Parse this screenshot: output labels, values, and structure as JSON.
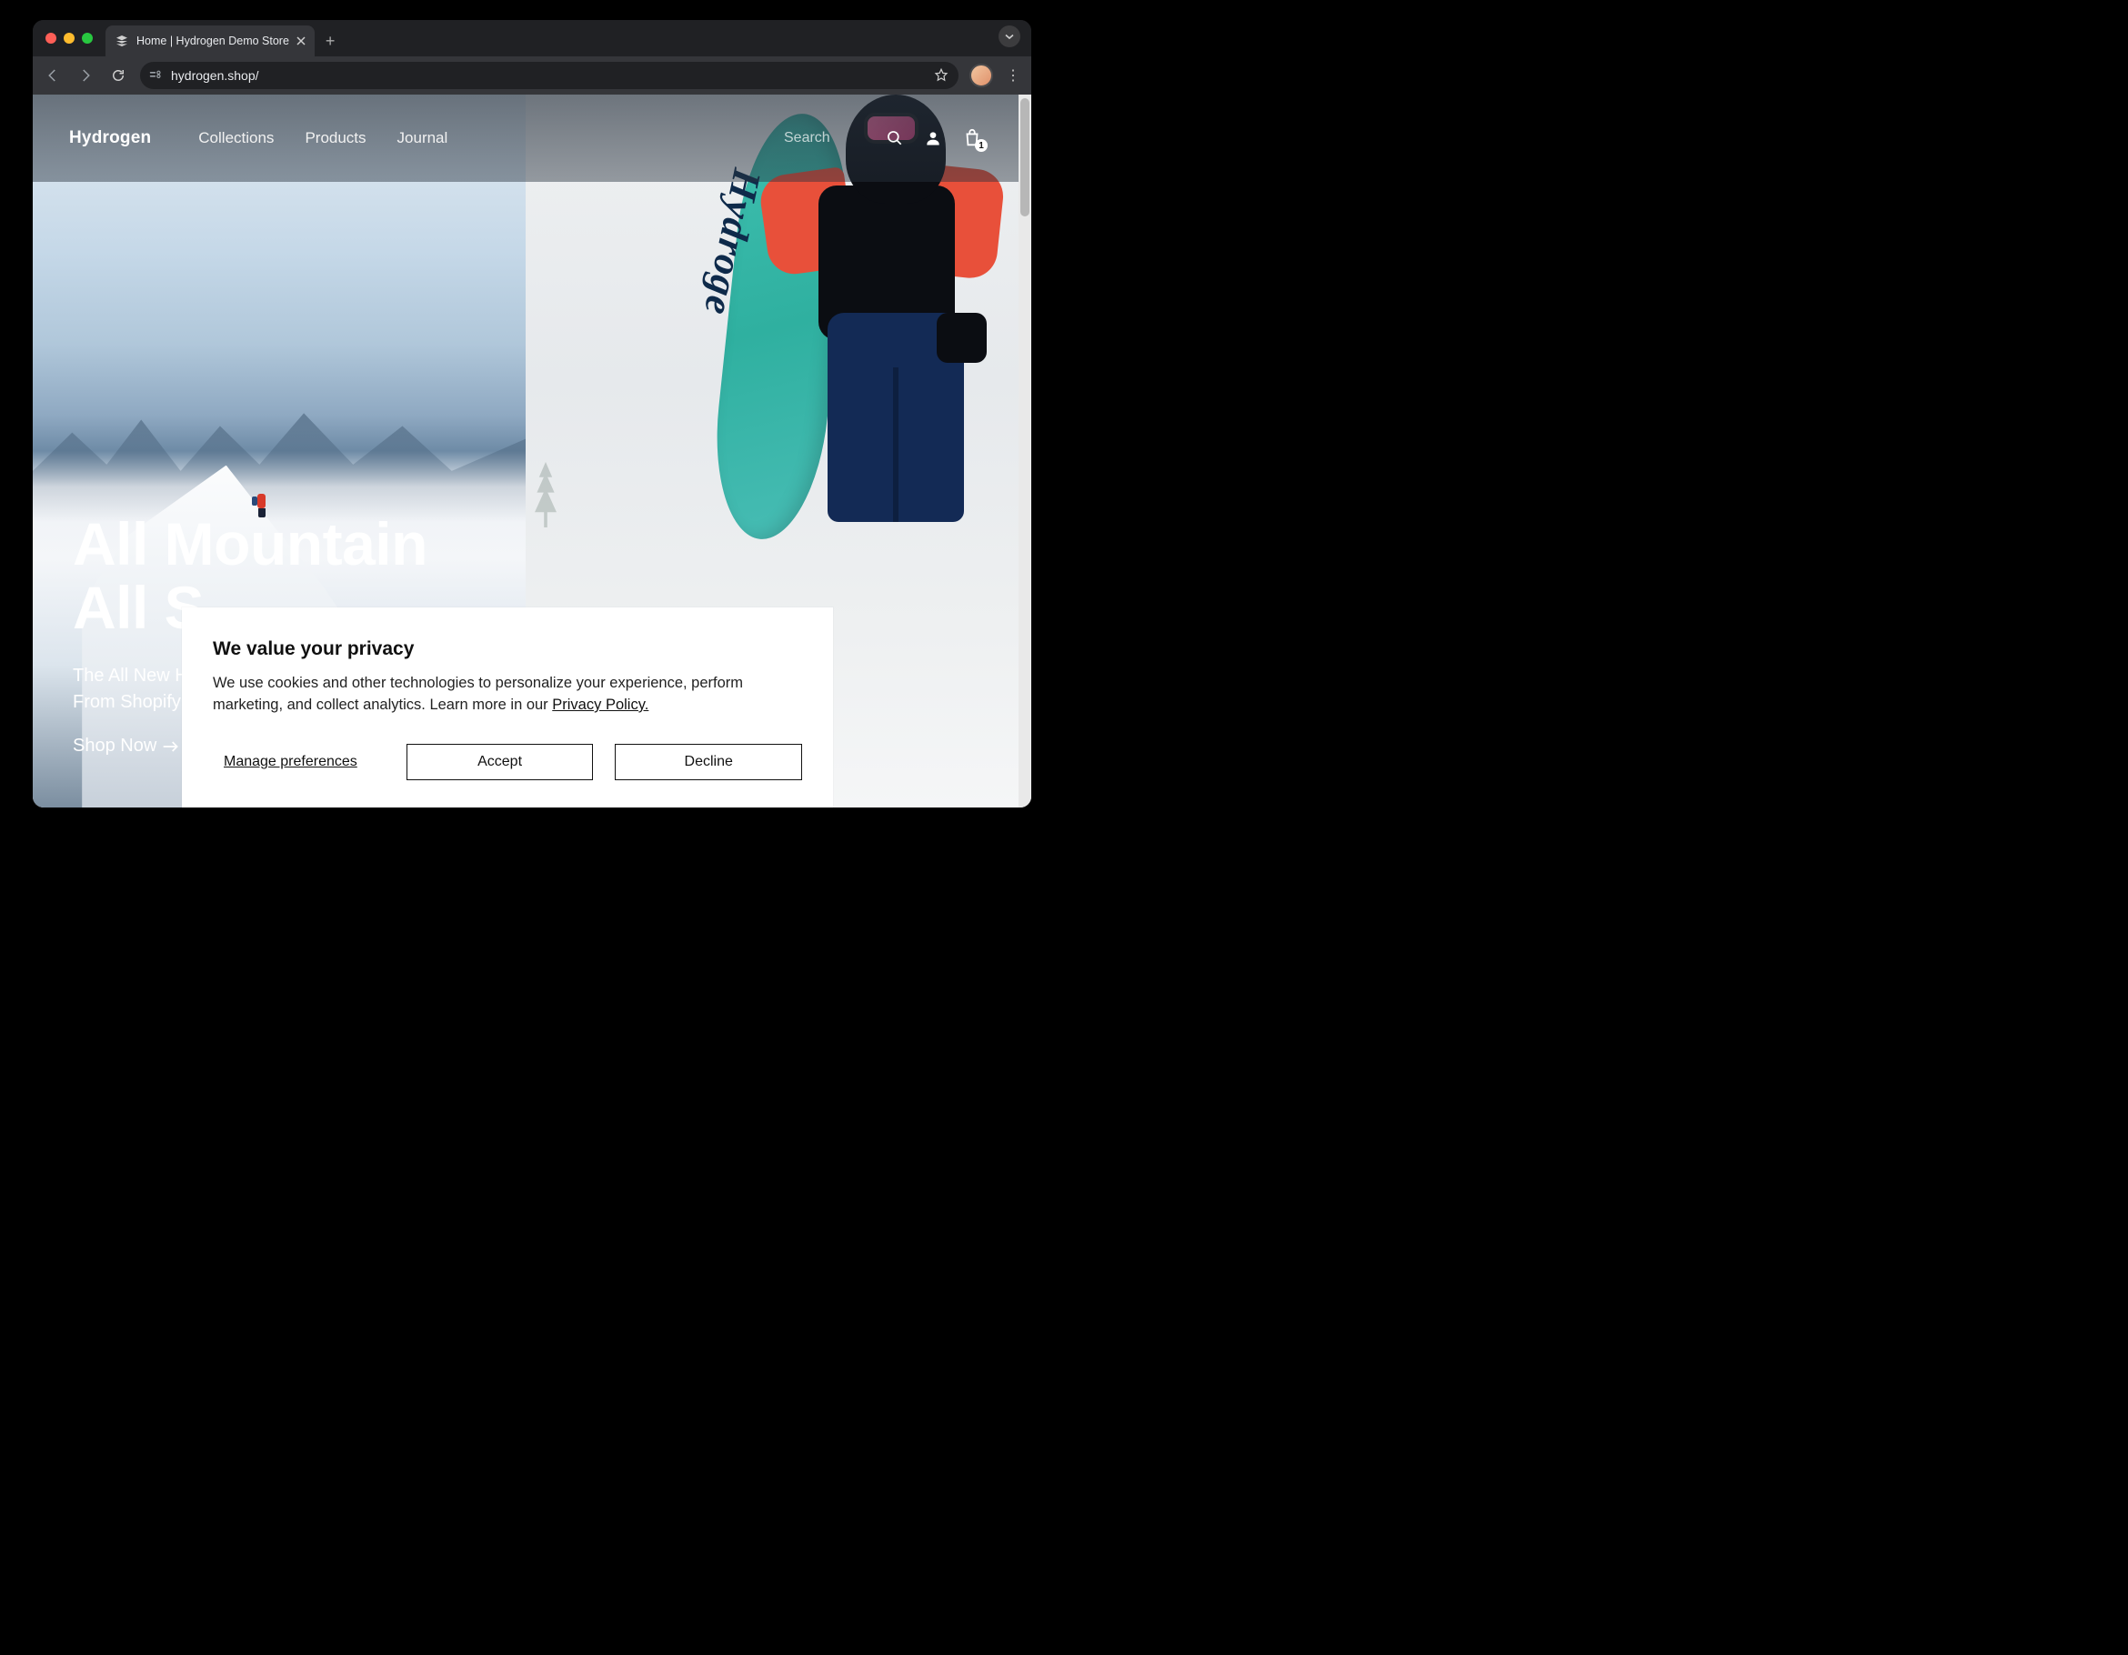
{
  "browser": {
    "tab_title": "Home | Hydrogen Demo Store",
    "url": "hydrogen.shop/"
  },
  "site_header": {
    "brand": "Hydrogen",
    "nav": [
      "Collections",
      "Products",
      "Journal"
    ],
    "search_placeholder": "Search",
    "cart_count": "1"
  },
  "hero": {
    "title_line1": "All Mountain",
    "title_line2": "All S",
    "subtitle_line1": "The All New H",
    "subtitle_line2": "From Shopify",
    "cta_label": "Shop Now",
    "board_text": "Hydroge"
  },
  "cookie": {
    "title": "We value your privacy",
    "body_pre": "We use cookies and other technologies to personalize your experience, perform marketing, and collect analytics. Learn more in our ",
    "policy_link": "Privacy Policy.",
    "manage_label": "Manage preferences",
    "accept_label": "Accept",
    "decline_label": "Decline"
  }
}
